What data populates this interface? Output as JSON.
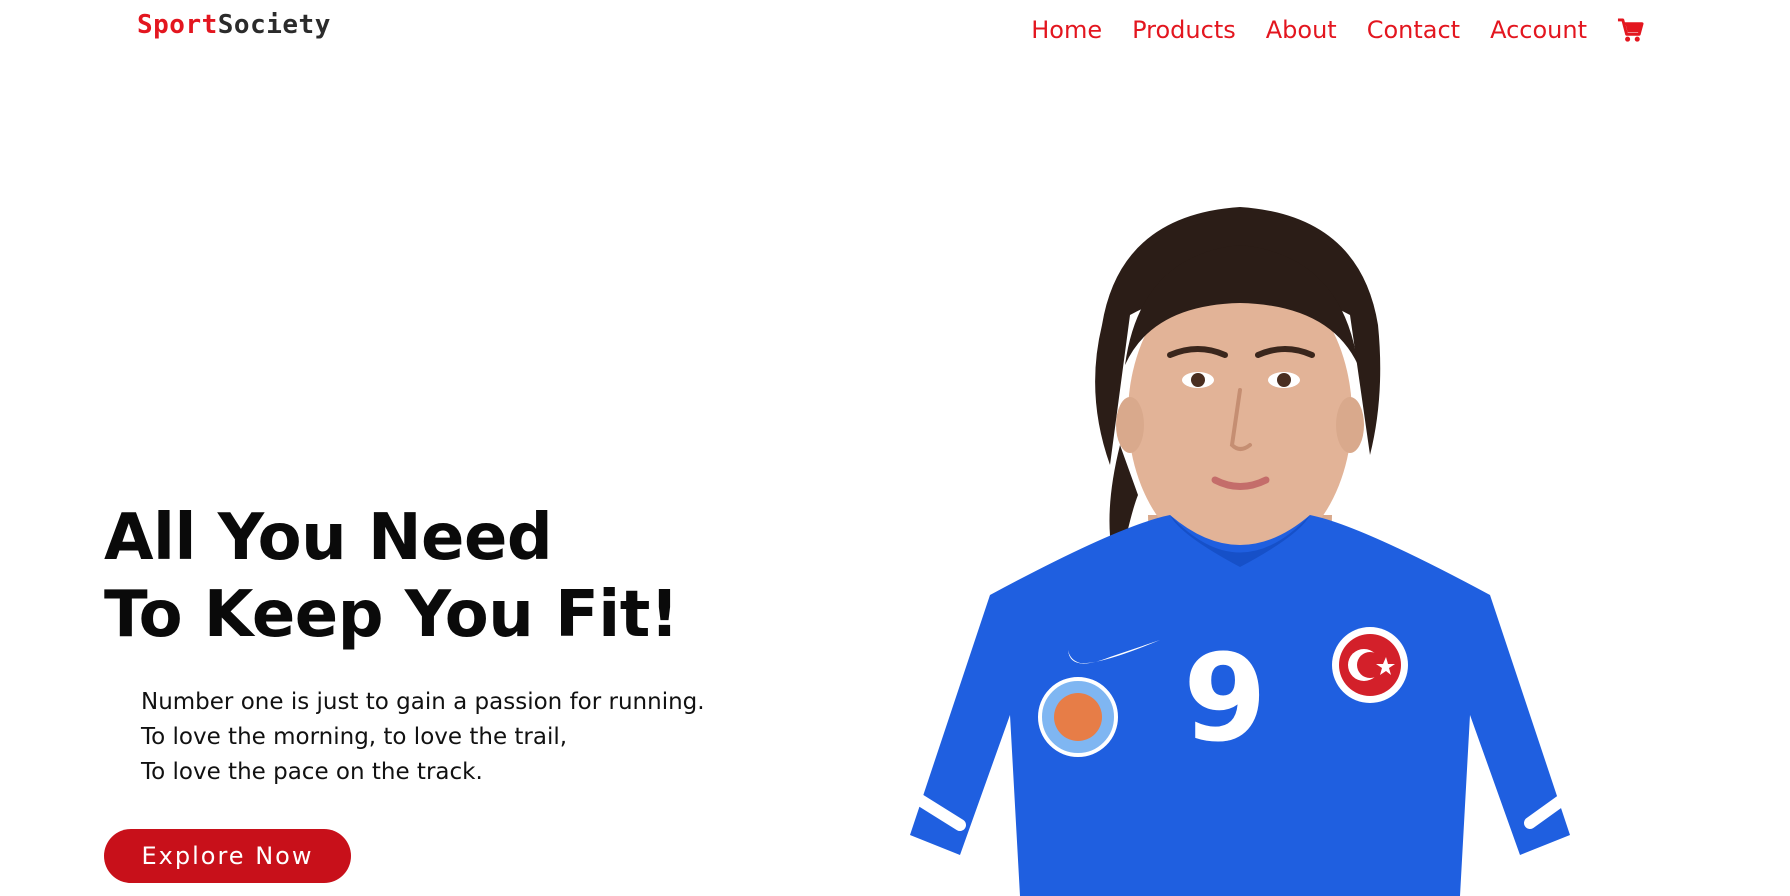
{
  "header": {
    "logo": {
      "accent": "Sport",
      "rest": "Society"
    },
    "nav": [
      "Home",
      "Products",
      "About",
      "Contact",
      "Account"
    ],
    "cart_icon": "shopping-cart-icon"
  },
  "hero": {
    "title_lines": [
      "All You Need",
      "To Keep You Fit!"
    ],
    "body_lines": [
      "Number one is just to gain a passion for running.",
      "To love the morning, to love the trail,",
      "To love the pace on the track."
    ],
    "cta": "Explore Now",
    "image": {
      "jersey_number": "9"
    }
  },
  "colors": {
    "brand_red": "#e3161f",
    "button_red": "#c8101a",
    "jersey_blue": "#1f5fe0"
  }
}
